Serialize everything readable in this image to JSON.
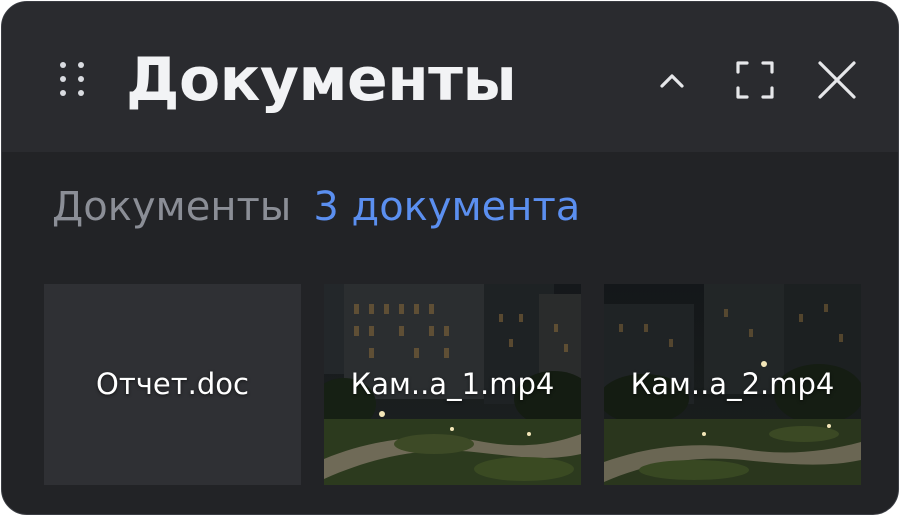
{
  "window": {
    "title": "Документы",
    "controls": [
      {
        "name": "collapse",
        "icon": "chevron-up-icon"
      },
      {
        "name": "expand",
        "icon": "fullscreen-icon"
      },
      {
        "name": "close",
        "icon": "close-icon"
      }
    ]
  },
  "summary": {
    "label": "Документы",
    "count": "3 документа"
  },
  "files": [
    {
      "name": "Отчет.doc",
      "kind": "document"
    },
    {
      "name": "Кам..а_1.mp4",
      "kind": "video",
      "thumbnail": "night-courtyard-scene"
    },
    {
      "name": "Кам..а_2.mp4",
      "kind": "video",
      "thumbnail": "night-courtyard-scene"
    }
  ],
  "colors": {
    "panel_bg": "#222326",
    "header_bg": "#2a2b2f",
    "accent": "#5b8ff0",
    "muted_text": "#8b8e96",
    "title_text": "#f2f3f5"
  }
}
